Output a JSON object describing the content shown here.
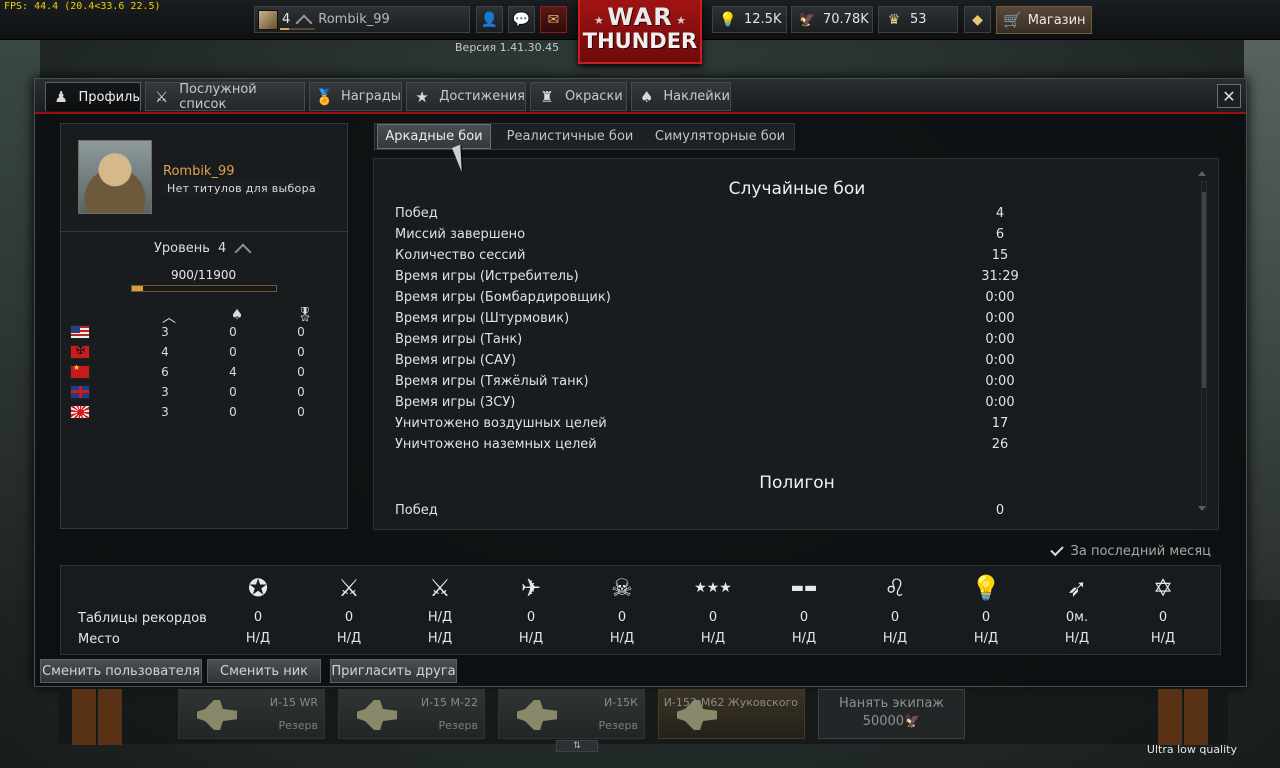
{
  "fps_text": "FPS: 44.4 (20.4<33.6 22.5)",
  "header": {
    "player_level": "4",
    "player_name": "Rombik_99",
    "version": "Версия 1.41.30.45",
    "logo_line1": "WAR",
    "logo_line2": "THUNDER",
    "lions": "12.5K",
    "eagles": "70.78K",
    "research": "53",
    "shop_label": "Магазин"
  },
  "tabs": [
    {
      "label": "Профиль",
      "icon": "soldier-icon"
    },
    {
      "label": "Послужной список",
      "icon": "crossed-swords-icon"
    },
    {
      "label": "Награды",
      "icon": "medal-icon"
    },
    {
      "label": "Достижения",
      "icon": "star-badge-icon"
    },
    {
      "label": "Окраски",
      "icon": "paint-icon"
    },
    {
      "label": "Наклейки",
      "icon": "spade-decal-icon"
    }
  ],
  "profile": {
    "name": "Rombik_99",
    "title": "Нет титулов для выбора",
    "level_label": "Уровень",
    "level_value": "4",
    "xp_text": "900/11900",
    "xp_progress": 0.0756,
    "nations": [
      {
        "flag": "us",
        "a": "3",
        "b": "0",
        "c": "0"
      },
      {
        "flag": "de",
        "a": "4",
        "b": "0",
        "c": "0"
      },
      {
        "flag": "su",
        "a": "6",
        "b": "4",
        "c": "0"
      },
      {
        "flag": "gb",
        "a": "3",
        "b": "0",
        "c": "0"
      },
      {
        "flag": "jp",
        "a": "3",
        "b": "0",
        "c": "0"
      }
    ]
  },
  "mode_tabs": [
    "Аркадные бои",
    "Реалистичные бои",
    "Симуляторные бои"
  ],
  "stats": {
    "section1_title": "Случайные бои",
    "rows": [
      {
        "label": "Побед",
        "value": "4"
      },
      {
        "label": "Миссий завершено",
        "value": "6"
      },
      {
        "label": "Количество сессий",
        "value": "15"
      },
      {
        "label": "Время игры (Истребитель)",
        "value": "31:29"
      },
      {
        "label": "Время игры (Бомбардировщик)",
        "value": "0:00"
      },
      {
        "label": "Время игры (Штурмовик)",
        "value": "0:00"
      },
      {
        "label": "Время игры (Танк)",
        "value": "0:00"
      },
      {
        "label": "Время игры (САУ)",
        "value": "0:00"
      },
      {
        "label": "Время игры (Тяжёлый танк)",
        "value": "0:00"
      },
      {
        "label": "Время игры (ЗСУ)",
        "value": "0:00"
      },
      {
        "label": "Уничтожено воздушных целей",
        "value": "17"
      },
      {
        "label": "Уничтожено наземных целей",
        "value": "26"
      }
    ],
    "section2_title": "Полигон",
    "partial_row": {
      "label": "Побед",
      "value": "0"
    }
  },
  "last_month_label": "За последний месяц",
  "leaderboard": {
    "row1_label": "Таблицы рекордов",
    "row2_label": "Место",
    "columns": [
      {
        "icon": "wins-star-icon",
        "v1": "0",
        "v2": "Н/Д"
      },
      {
        "icon": "crossed-swords-icon",
        "v1": "0",
        "v2": "Н/Д"
      },
      {
        "icon": "crossed-swords-star-icon",
        "v1": "Н/Д",
        "v2": "Н/Д"
      },
      {
        "icon": "plane-icon",
        "v1": "0",
        "v2": "Н/Д"
      },
      {
        "icon": "skull-icon",
        "v1": "0",
        "v2": "Н/Д"
      },
      {
        "icon": "stars-row-icon",
        "v1": "0",
        "v2": "Н/Д"
      },
      {
        "icon": "tanks-row-icon",
        "v1": "0",
        "v2": "Н/Д"
      },
      {
        "icon": "lion-icon",
        "v1": "0",
        "v2": "Н/Д"
      },
      {
        "icon": "lightbulb-icon",
        "v1": "0",
        "v2": "Н/Д"
      },
      {
        "icon": "time-arrow-icon",
        "v1": "0м.",
        "v2": "Н/Д"
      },
      {
        "icon": "star-diamond-icon",
        "v1": "0",
        "v2": "Н/Д"
      }
    ]
  },
  "buttons": {
    "switch_user": "Сменить пользователя",
    "change_nick": "Сменить ник",
    "invite_friend": "Пригласить друга"
  },
  "hangar": {
    "slots": [
      {
        "name": "И-15 WR",
        "status": "Резерв"
      },
      {
        "name": "И-15 М-22",
        "status": "Резерв"
      },
      {
        "name": "И-15К",
        "status": "Резерв"
      },
      {
        "name": "И-153-М62 Жуковского",
        "status": ""
      }
    ],
    "hire_label": "Нанять экипаж",
    "hire_price": "50000"
  },
  "quality_label": "Ultra low quality"
}
